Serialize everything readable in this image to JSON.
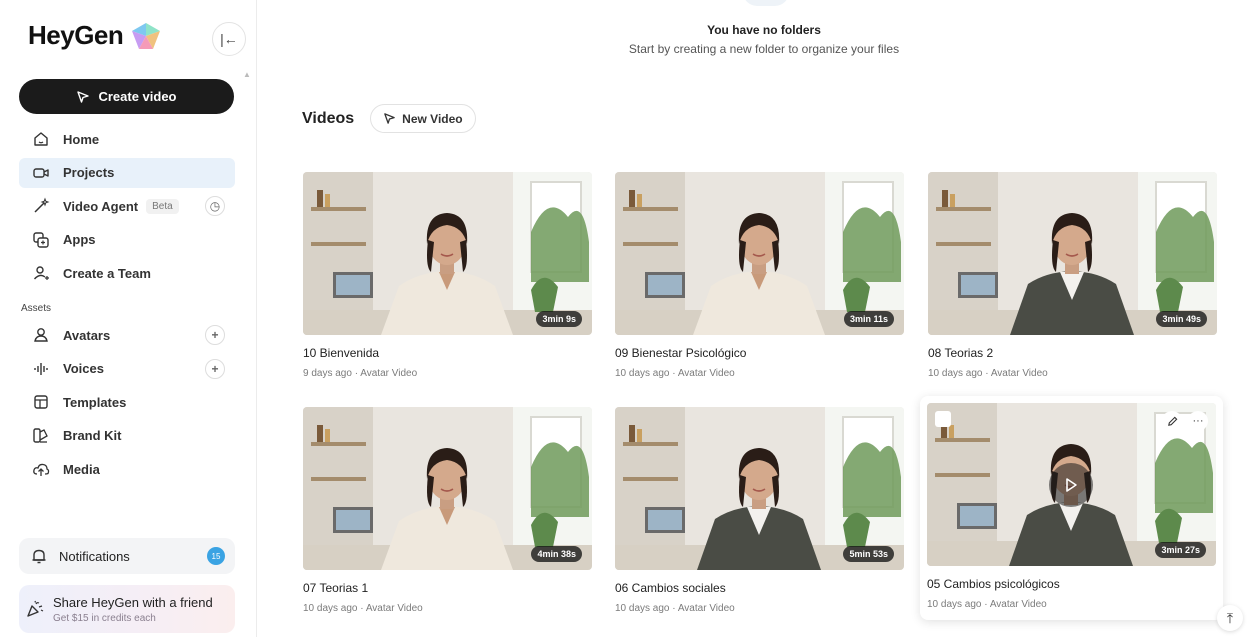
{
  "brand": {
    "name": "HeyGen"
  },
  "sidebar": {
    "create_label": "Create video",
    "items": [
      {
        "label": "Home",
        "icon": "home-icon"
      },
      {
        "label": "Projects",
        "icon": "video-camera-icon",
        "active": true
      },
      {
        "label": "Video Agent",
        "icon": "magic-wand-icon",
        "badge": "Beta",
        "extra_icon": "history-icon"
      },
      {
        "label": "Apps",
        "icon": "apps-icon"
      },
      {
        "label": "Create a Team",
        "icon": "add-user-icon"
      }
    ],
    "assets_label": "Assets",
    "assets": [
      {
        "label": "Avatars",
        "icon": "avatar-icon",
        "extra_icon": "plus-icon"
      },
      {
        "label": "Voices",
        "icon": "voice-waveform-icon",
        "extra_icon": "plus-icon"
      },
      {
        "label": "Templates",
        "icon": "template-icon"
      },
      {
        "label": "Brand Kit",
        "icon": "brand-kit-icon"
      },
      {
        "label": "Media",
        "icon": "cloud-upload-icon"
      }
    ],
    "notifications": {
      "label": "Notifications",
      "count": "15"
    },
    "share": {
      "title": "Share HeyGen with a friend",
      "subtitle": "Get $15 in credits each"
    }
  },
  "main": {
    "empty_title": "You have no folders",
    "empty_subtitle": "Start by creating a new folder to organize your files",
    "videos_title": "Videos",
    "new_video_label": "New Video",
    "videos": [
      {
        "title": "10 Bienvenida",
        "meta": "9 days ago · Avatar Video",
        "duration": "3min 9s",
        "outfit": "blouse"
      },
      {
        "title": "09 Bienestar Psicológico",
        "meta": "10 days ago · Avatar Video",
        "duration": "3min 11s",
        "outfit": "blouse"
      },
      {
        "title": "08 Teorias 2",
        "meta": "10 days ago · Avatar Video",
        "duration": "3min 49s",
        "outfit": "blazer"
      },
      {
        "title": "07 Teorias 1",
        "meta": "10 days ago · Avatar Video",
        "duration": "4min 38s",
        "outfit": "blouse"
      },
      {
        "title": "06 Cambios sociales",
        "meta": "10 days ago · Avatar Video",
        "duration": "5min 53s",
        "outfit": "blazer"
      },
      {
        "title": "05 Cambios psicológicos",
        "meta": "10 days ago · Avatar Video",
        "duration": "3min 27s",
        "outfit": "blazer",
        "hovered": true
      }
    ]
  },
  "colors": {
    "accent_blue": "#3aa3e3",
    "active_bg": "#e8f1fa",
    "create_bg": "#1b1b1b"
  }
}
